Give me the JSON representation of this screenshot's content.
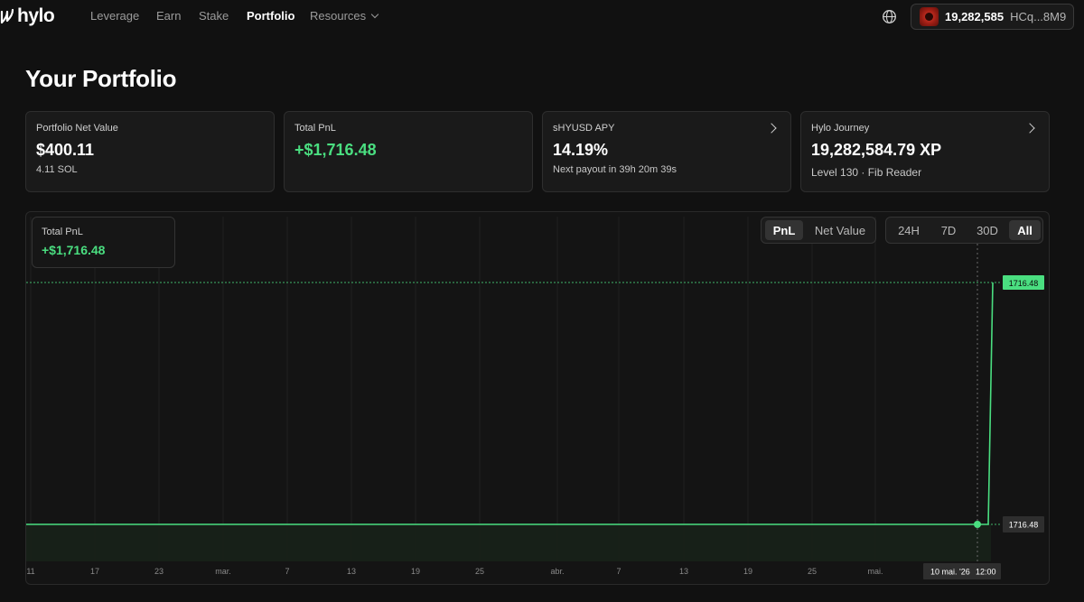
{
  "nav": {
    "logo_text": "hylo",
    "links": [
      "Leverage",
      "Earn",
      "Stake",
      "Portfolio",
      "Resources"
    ],
    "active": "Portfolio",
    "globe_icon": "globe-icon",
    "wallet": {
      "xp": "19,282,585",
      "address": "HCq...8M9"
    }
  },
  "page": {
    "title": "Your Portfolio"
  },
  "cards": [
    {
      "label": "Portfolio Net Value",
      "value": "$400.11",
      "sub": "4.11 SOL"
    },
    {
      "label": "Total PnL",
      "value": "+$1,716.48"
    },
    {
      "label": "sHYUSD APY",
      "value": "14.19%",
      "sub": "Next payout in 39h 20m 39s"
    },
    {
      "label": "Hylo Journey",
      "value": "19,282,584.79 XP",
      "sub": "Level 130 · Fib Reader"
    }
  ],
  "chart_panel": {
    "tooltip": {
      "label": "Total PnL",
      "value": "+$1,716.48"
    },
    "metric_toggle": [
      "PnL",
      "Net Value"
    ],
    "metric_active": "PnL",
    "range_toggle": [
      "24H",
      "7D",
      "30D",
      "All"
    ],
    "range_active": "All"
  },
  "colors": {
    "accent_green": "#4ade80",
    "background": "#111111",
    "card": "#1a1a1a"
  },
  "chart_data": {
    "type": "line",
    "x_tick_labels": [
      "11",
      "17",
      "23",
      "mar.",
      "7",
      "13",
      "19",
      "25",
      "abr.",
      "7",
      "13",
      "19",
      "25",
      "mai."
    ],
    "crosshair_date": "10 mai. '26",
    "crosshair_time": "12:00",
    "series": [
      {
        "values": [
          0,
          0,
          1716.48
        ]
      }
    ],
    "last_value_label": "1716.48",
    "crosshair_value_label": "1716.48",
    "ylim": [
      0,
      1716.48
    ],
    "grid": true
  }
}
